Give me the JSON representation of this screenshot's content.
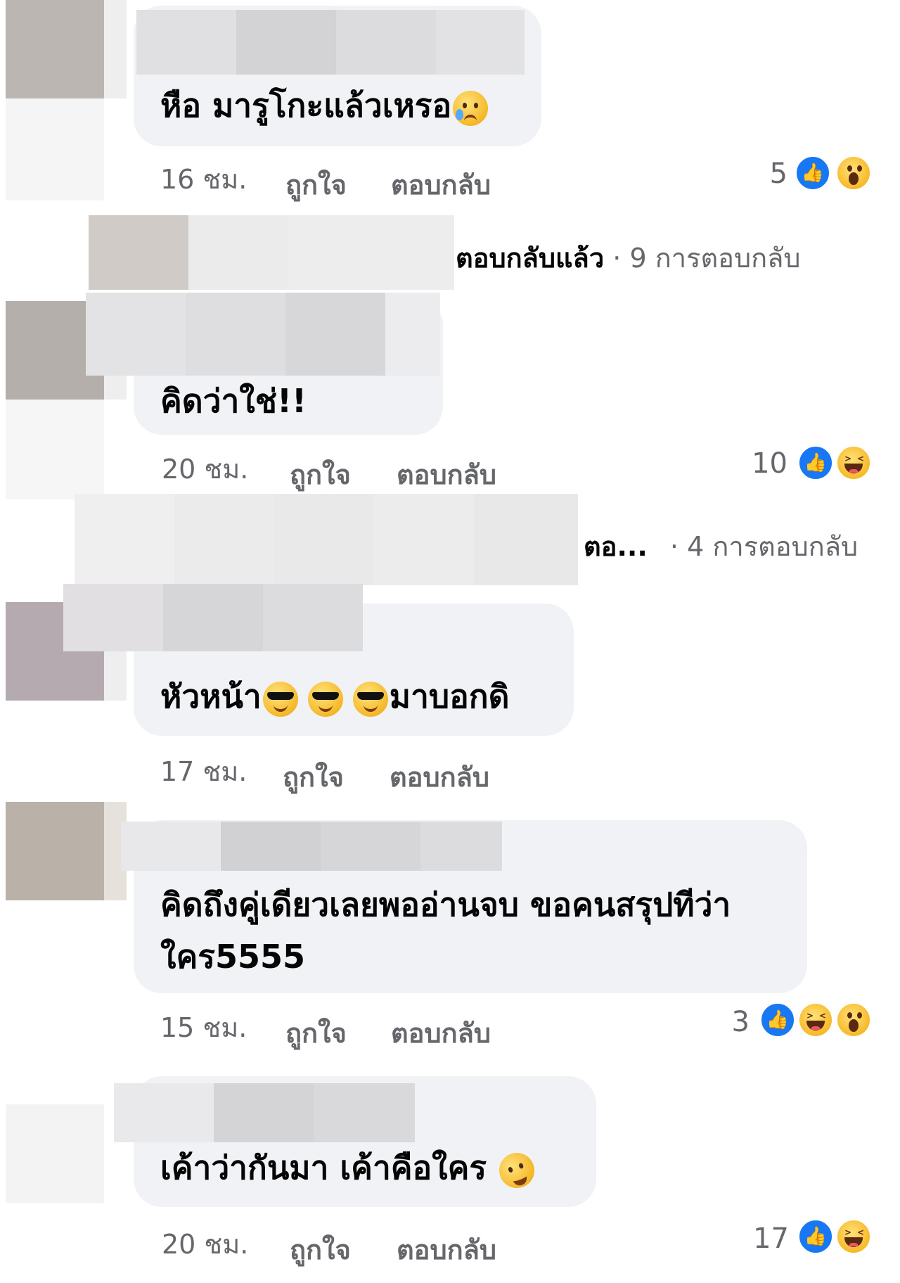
{
  "comments": [
    {
      "text": "หือ มารูโกะแล้วเหรอ",
      "emoji": "sad-sweat-emoji",
      "time": "16 ชม.",
      "like": "ถูกใจ",
      "reply": "ตอบกลับ",
      "reaction_count": "5",
      "reactions": [
        "like-icon",
        "wow-icon"
      ]
    },
    {
      "text": "คิดว่าใช่!!",
      "time": "20 ชม.",
      "like": "ถูกใจ",
      "reply": "ตอบกลับ",
      "reaction_count": "10",
      "reactions": [
        "like-icon",
        "haha-icon"
      ]
    },
    {
      "text_before": "หัวหน้า",
      "emoji": "sunglasses-emoji",
      "text_after": "มาบอกดิ",
      "time": "17 ชม.",
      "like": "ถูกใจ",
      "reply": "ตอบกลับ"
    },
    {
      "text_line1": "คิดถึงคู่เดียวเลยพออ่านจบ ขอคนสรุปทีว่า",
      "text_line2": "ใคร5555",
      "time": "15 ชม.",
      "like": "ถูกใจ",
      "reply": "ตอบกลับ",
      "reaction_count": "3",
      "reactions": [
        "like-icon",
        "haha-icon",
        "wow-icon"
      ]
    },
    {
      "text": "เค้าว่ากันมา เค้าคือใคร",
      "emoji": "rofl-emoji",
      "time": "20 ชม.",
      "like": "ถูกใจ",
      "reply": "ตอบกลับ",
      "reaction_count": "17",
      "reactions": [
        "like-icon",
        "haha-icon"
      ]
    }
  ],
  "reply_threads": [
    {
      "label": "ตอบกลับแล้ว",
      "separator": "·",
      "count": "9 การตอบกลับ"
    },
    {
      "label": "ตอ...",
      "separator": "·",
      "count": "4 การตอบกลับ"
    }
  ],
  "colors": {
    "bubble": "#f0f2f5",
    "meta": "#65676b",
    "like_blue": "#1877f2"
  }
}
